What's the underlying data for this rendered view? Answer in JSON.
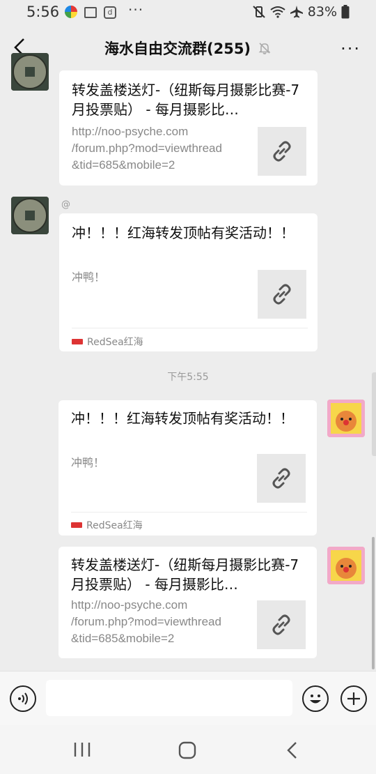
{
  "status_bar": {
    "time": "5:56",
    "more": "···",
    "battery": "83%"
  },
  "header": {
    "title": "海水自由交流群(255)",
    "more": "···"
  },
  "messages": [
    {
      "side": "left",
      "title": "转发盖楼送灯-（纽斯每月摄影比赛-7月投票贴） - 每月摄影比…",
      "url_lines": [
        "http://noo-psyche.com",
        "/forum.php?mod=viewthread",
        "&tid=685&mobile=2"
      ]
    },
    {
      "side": "left",
      "sender": "@",
      "title": "冲！！！红海转发顶帖有奖活动！！",
      "desc": "冲鸭！",
      "source": "RedSea红海"
    },
    {
      "timestamp": "下午5:55"
    },
    {
      "side": "right",
      "title": "冲！！！红海转发顶帖有奖活动！！",
      "desc": "冲鸭！",
      "source": "RedSea红海"
    },
    {
      "side": "right",
      "title": "转发盖楼送灯-（纽斯每月摄影比赛-7月投票贴） - 每月摄影比…",
      "url_lines": [
        "http://noo-psyche.com",
        "/forum.php?mod=viewthread",
        "&tid=685&mobile=2"
      ]
    }
  ],
  "icons": {
    "back": "chevron-left-icon",
    "mute": "bell-off-icon",
    "link": "link-icon",
    "voice": "voice-icon",
    "emoji": "emoji-icon",
    "add": "plus-icon"
  },
  "colors": {
    "background": "#ededed",
    "card": "#ffffff",
    "muted_text": "#888888"
  }
}
